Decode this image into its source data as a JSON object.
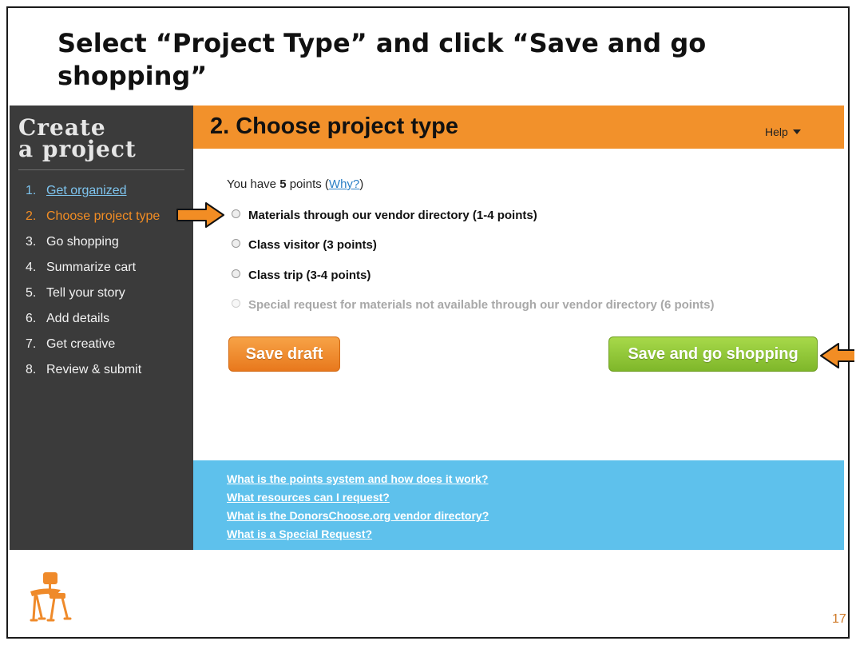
{
  "slide": {
    "title": "Select “Project Type” and click “Save and go shopping”",
    "page_number": "17",
    "logo_icon": "school-chair-icon"
  },
  "sidebar": {
    "logo_line1": "Create",
    "logo_line2": "a project",
    "steps": [
      {
        "num": "1.",
        "label": "Get organized",
        "state": "done"
      },
      {
        "num": "2.",
        "label": "Choose project type",
        "state": "active"
      },
      {
        "num": "3.",
        "label": "Go shopping",
        "state": "pending"
      },
      {
        "num": "4.",
        "label": "Summarize cart",
        "state": "pending"
      },
      {
        "num": "5.",
        "label": "Tell your story",
        "state": "pending"
      },
      {
        "num": "6.",
        "label": "Add details",
        "state": "pending"
      },
      {
        "num": "7.",
        "label": "Get creative",
        "state": "pending"
      },
      {
        "num": "8.",
        "label": "Review & submit",
        "state": "pending"
      }
    ]
  },
  "header": {
    "title": "2. Choose project type",
    "help_label": "Help",
    "help_icon": "caret-down-icon"
  },
  "points": {
    "prefix": "You have",
    "value": "5",
    "suffix": "points",
    "why_open": "(",
    "why_link": "Why?",
    "why_close": ")"
  },
  "options": [
    {
      "label": "Materials through our vendor directory (1-4 points)",
      "enabled": true
    },
    {
      "label": "Class visitor (3 points)",
      "enabled": true
    },
    {
      "label": "Class trip (3-4 points)",
      "enabled": true
    },
    {
      "label": "Special request for materials not available through our vendor directory (6 points)",
      "enabled": false
    }
  ],
  "buttons": {
    "save_draft": "Save draft",
    "save_and_shop": "Save and go shopping"
  },
  "faq": [
    "What is the points system and how does it work?",
    "What resources can I request?",
    "What is the DonorsChoose.org vendor directory?",
    "What is a Special Request?"
  ],
  "colors": {
    "banner": "#f2912b",
    "sidebar": "#3b3b3b",
    "active_step": "#f28d24",
    "save_draft": "#ef8a2a",
    "save_and_shop": "#94c83a",
    "faq_bar": "#5ec1ec",
    "annotation_arrow": "#f28d24"
  }
}
